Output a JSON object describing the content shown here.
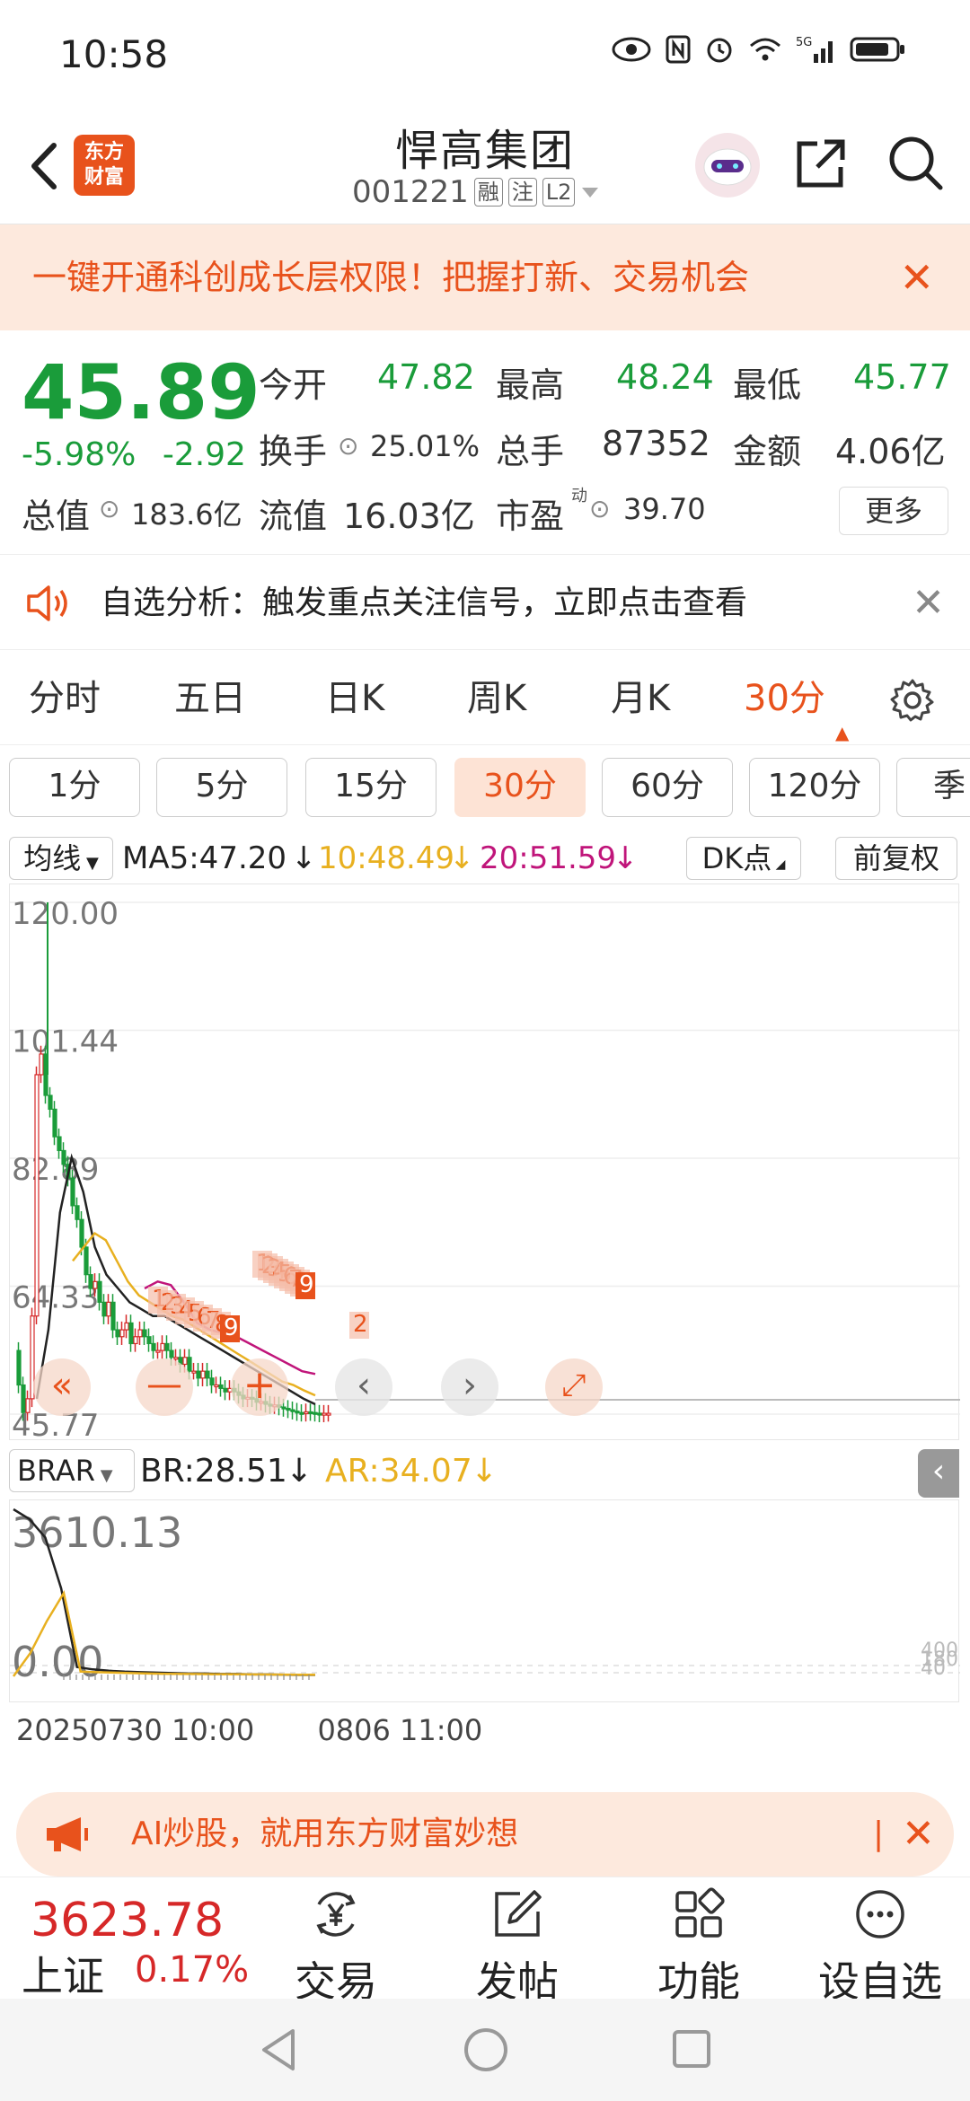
{
  "status_bar": {
    "time": "10:58"
  },
  "header": {
    "stock_name": "悍高集团",
    "stock_code": "001221",
    "tags": [
      "融",
      "注",
      "L2"
    ],
    "logo_text_1": "东方",
    "logo_text_2": "财富"
  },
  "banner": {
    "text": "一键开通科创成长层权限！把握打新、交易机会"
  },
  "quote": {
    "price": "45.89",
    "change_pct": "-5.98%",
    "change_amt": "-2.92",
    "open_label": "今开",
    "open": "47.82",
    "high_label": "最高",
    "high": "48.24",
    "low_label": "最低",
    "low": "45.77",
    "turnover_label": "换手",
    "turnover": "25.01%",
    "volume_label": "总手",
    "volume": "87352",
    "amount_label": "金额",
    "amount": "4.06亿",
    "mcap_label": "总值",
    "mcap": "183.6亿",
    "float_label": "流值",
    "float": "16.03亿",
    "pe_label": "市盈",
    "pe_sup": "动",
    "pe": "39.70",
    "more": "更多"
  },
  "alert": {
    "text": "自选分析：触发重点关注信号，立即点击查看"
  },
  "period_tabs": [
    {
      "label": "分时"
    },
    {
      "label": "五日"
    },
    {
      "label": "日K"
    },
    {
      "label": "周K"
    },
    {
      "label": "月K"
    },
    {
      "label": "30分"
    }
  ],
  "minute_tabs": [
    "1分",
    "5分",
    "15分",
    "30分",
    "60分",
    "120分",
    "季"
  ],
  "ma_row": {
    "selector": "均线",
    "ma5": "MA5:47.20",
    "ma10": "10:48.49",
    "ma20": "20:51.59",
    "dk": "DK点",
    "adjust": "前复权",
    "colors": {
      "ma5": "#222222",
      "ma10": "#e8b020",
      "ma20": "#c0157a",
      "up": "#d62828",
      "down": "#1a9c3a"
    }
  },
  "chart_data": [
    {
      "type": "candlestick",
      "y_tick_labels": [
        "120.00",
        "101.44",
        "82.89",
        "64.33",
        "45.77"
      ],
      "ylim": [
        45.77,
        120.0
      ],
      "annotations": [
        "1",
        "2",
        "3",
        "4",
        "5",
        "6",
        "7",
        "8",
        "9",
        "1",
        "2",
        "3",
        "4",
        "5",
        "6",
        "7",
        "8",
        "9",
        "2"
      ],
      "series": [
        {
          "name": "MA5",
          "values": [
            48,
            58,
            75,
            83,
            78,
            70,
            66,
            64,
            62,
            61,
            60,
            60,
            59,
            58,
            57,
            56,
            55,
            54,
            53,
            52,
            51,
            50,
            49,
            48,
            47.2
          ]
        },
        {
          "name": "10",
          "values": [
            68,
            70,
            72,
            71,
            68,
            65,
            63,
            62,
            61,
            60,
            59.5,
            58.5,
            57.5,
            56.5,
            55.5,
            54.5,
            53.5,
            52.5,
            51.5,
            50.5,
            50,
            49.2,
            48.49
          ]
        },
        {
          "name": "20",
          "values": [
            64,
            65,
            64.5,
            62,
            59,
            58,
            57.5,
            57,
            56,
            55,
            54,
            53,
            52,
            51.59
          ]
        }
      ]
    },
    {
      "type": "line",
      "y_tick_labels": [
        "3610.13",
        "0.00"
      ],
      "series": [
        {
          "name": "BR:28.51",
          "values": [
            3610,
            3400,
            3000,
            1900,
            200,
            150,
            120,
            100,
            90,
            80,
            70,
            60,
            60,
            50,
            50,
            40,
            40,
            35,
            30,
            28.51
          ]
        },
        {
          "name": "AR:34.07",
          "values": [
            0,
            500,
            1200,
            1800,
            100,
            90,
            80,
            70,
            60,
            55,
            50,
            48,
            45,
            43,
            40,
            38,
            36,
            35,
            34.07
          ]
        }
      ],
      "right_labels": [
        "400",
        "180",
        "40"
      ]
    }
  ],
  "sub_row": {
    "selector": "BRAR",
    "br": "BR:28.51",
    "ar": "AR:34.07"
  },
  "dates": {
    "d1": "20250730 10:00",
    "d2": "0806 11:00"
  },
  "ad": {
    "text": "AI炒股，就用东方财富妙想"
  },
  "bottom": {
    "index_value": "3623.78",
    "index_name": "上证",
    "index_change": "0.17%",
    "tabs": [
      {
        "label": "交易",
        "icon": "yen-cycle-icon"
      },
      {
        "label": "发帖",
        "icon": "edit-icon"
      },
      {
        "label": "功能",
        "icon": "grid-icon"
      },
      {
        "label": "设自选",
        "icon": "more-dots-icon"
      }
    ]
  }
}
